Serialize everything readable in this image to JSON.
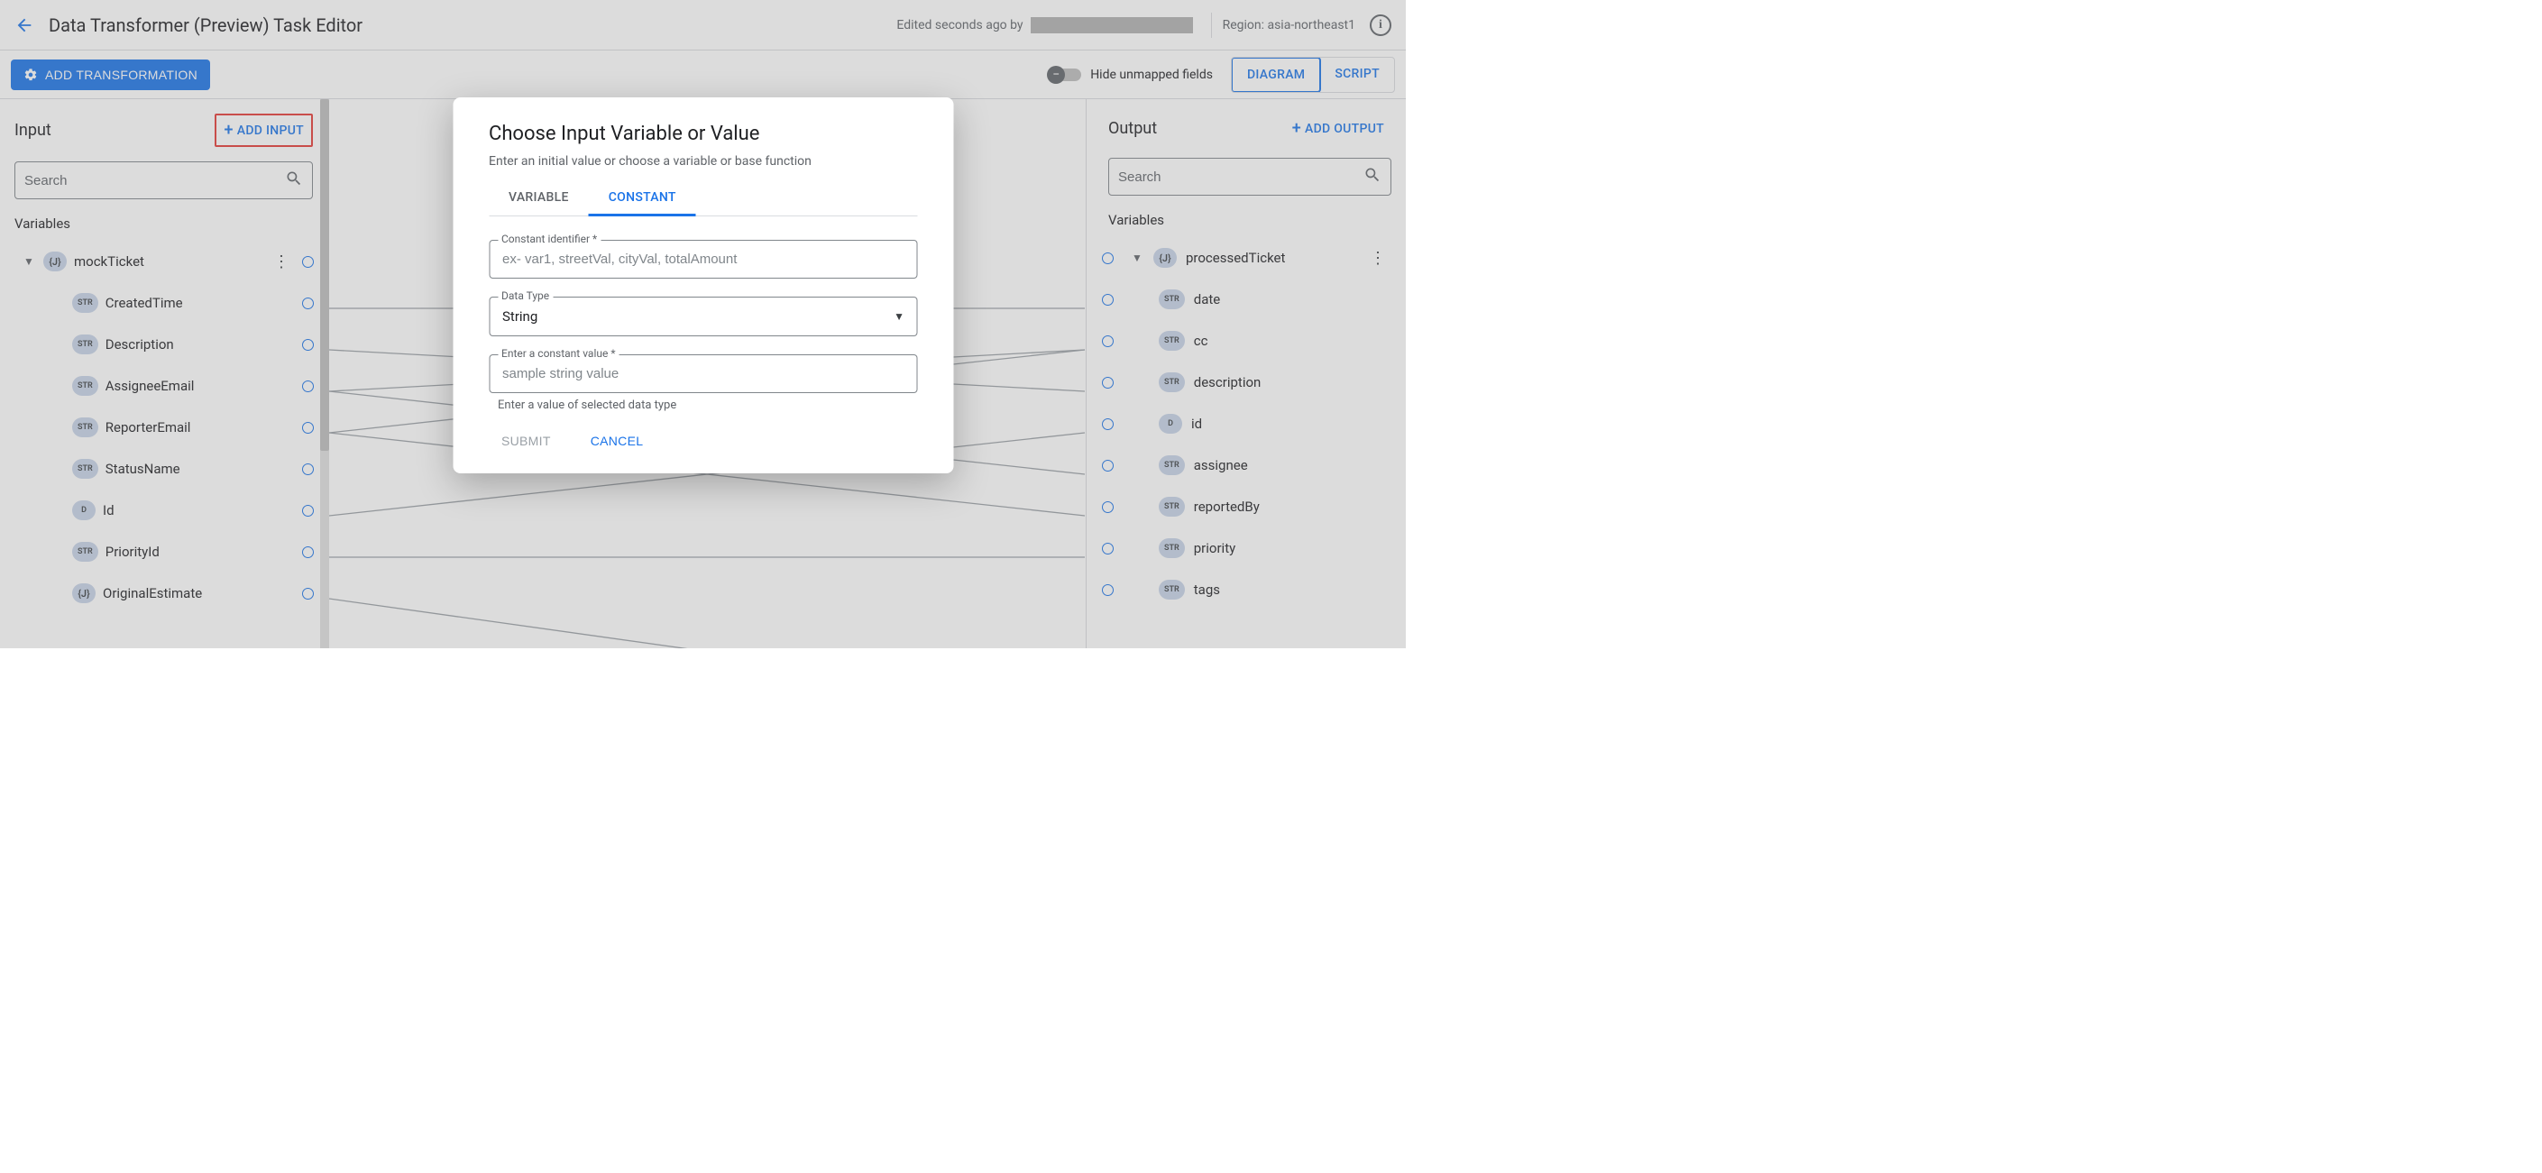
{
  "header": {
    "title": "Data Transformer (Preview) Task Editor",
    "edited_prefix": "Edited seconds ago by",
    "region_label": "Region: asia-northeast1"
  },
  "toolbar": {
    "add_transformation": "ADD TRANSFORMATION",
    "hide_unmapped": "Hide unmapped fields",
    "tab_diagram": "DIAGRAM",
    "tab_script": "SCRIPT"
  },
  "input_panel": {
    "title": "Input",
    "add_button": "ADD INPUT",
    "search_placeholder": "Search",
    "section": "Variables",
    "root": {
      "type": "{J}",
      "name": "mockTicket"
    },
    "fields": [
      {
        "type": "STR",
        "name": "CreatedTime"
      },
      {
        "type": "STR",
        "name": "Description"
      },
      {
        "type": "STR",
        "name": "AssigneeEmail"
      },
      {
        "type": "STR",
        "name": "ReporterEmail"
      },
      {
        "type": "STR",
        "name": "StatusName"
      },
      {
        "type": "D",
        "name": "Id"
      },
      {
        "type": "STR",
        "name": "PriorityId"
      },
      {
        "type": "{J}",
        "name": "OriginalEstimate"
      }
    ]
  },
  "output_panel": {
    "title": "Output",
    "add_button": "ADD OUTPUT",
    "search_placeholder": "Search",
    "section": "Variables",
    "root": {
      "type": "{J}",
      "name": "processedTicket"
    },
    "fields": [
      {
        "type": "STR",
        "name": "date"
      },
      {
        "type": "STR",
        "name": "cc"
      },
      {
        "type": "STR",
        "name": "description"
      },
      {
        "type": "D",
        "name": "id"
      },
      {
        "type": "STR",
        "name": "assignee"
      },
      {
        "type": "STR",
        "name": "reportedBy"
      },
      {
        "type": "STR",
        "name": "priority"
      },
      {
        "type": "STR",
        "name": "tags"
      }
    ]
  },
  "modal": {
    "title": "Choose Input Variable or Value",
    "subtitle": "Enter an initial value or choose a variable or base function",
    "tab_variable": "VARIABLE",
    "tab_constant": "CONSTANT",
    "field_identifier_label": "Constant identifier *",
    "field_identifier_placeholder": "ex- var1, streetVal, cityVal, totalAmount",
    "field_datatype_label": "Data Type",
    "field_datatype_value": "String",
    "field_constvalue_label": "Enter a constant value *",
    "field_constvalue_placeholder": "sample string value",
    "helper": "Enter a value of selected data type",
    "submit": "SUBMIT",
    "cancel": "CANCEL"
  }
}
